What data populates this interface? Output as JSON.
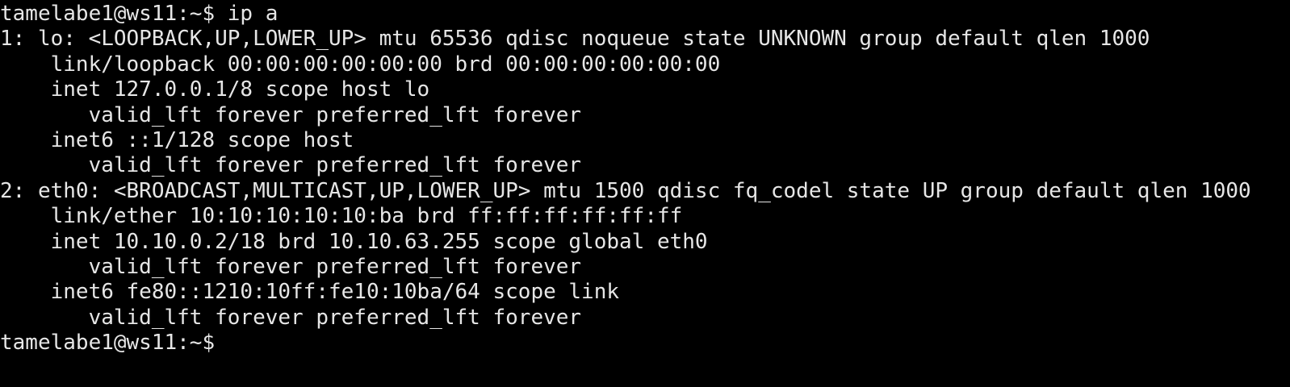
{
  "terminal": {
    "lines": [
      "tamelabe1@ws11:~$ ip a",
      "1: lo: <LOOPBACK,UP,LOWER_UP> mtu 65536 qdisc noqueue state UNKNOWN group default qlen 1000",
      "    link/loopback 00:00:00:00:00:00 brd 00:00:00:00:00:00",
      "    inet 127.0.0.1/8 scope host lo",
      "       valid_lft forever preferred_lft forever",
      "    inet6 ::1/128 scope host",
      "       valid_lft forever preferred_lft forever",
      "2: eth0: <BROADCAST,MULTICAST,UP,LOWER_UP> mtu 1500 qdisc fq_codel state UP group default qlen 1000",
      "    link/ether 10:10:10:10:10:ba brd ff:ff:ff:ff:ff:ff",
      "    inet 10.10.0.2/18 brd 10.10.63.255 scope global eth0",
      "       valid_lft forever preferred_lft forever",
      "    inet6 fe80::1210:10ff:fe10:10ba/64 scope link",
      "       valid_lft forever preferred_lft forever",
      "tamelabe1@ws11:~$"
    ],
    "colors": {
      "background": "#000000",
      "foreground": "#e6e6e6"
    }
  }
}
